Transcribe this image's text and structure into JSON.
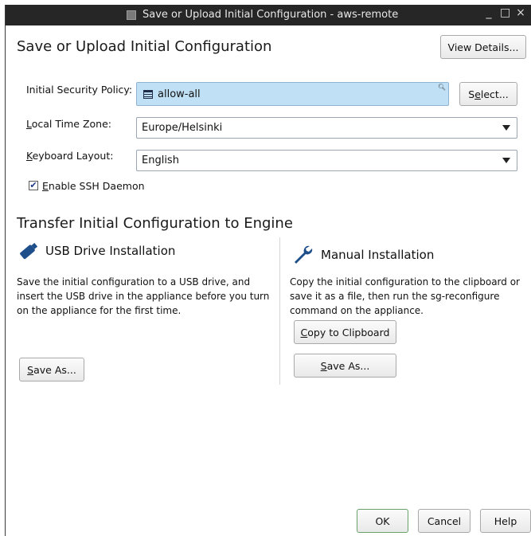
{
  "window": {
    "title": "Save or Upload Initial Configuration - aws-remote",
    "controls": [
      "_",
      "□",
      "×"
    ]
  },
  "header": {
    "title": "Save or Upload Initial Configuration",
    "view_details_label": "View Details..."
  },
  "form": {
    "policy_label": "Initial Security Policy:",
    "policy_value": "allow-all",
    "select_button": {
      "pre": "S",
      "under": "e",
      "post": "lect..."
    },
    "timezone_label": {
      "pre": "",
      "under": "L",
      "post": "ocal Time Zone:"
    },
    "timezone_value": "Europe/Helsinki",
    "keyboard_label": {
      "pre": "",
      "under": "K",
      "post": "eyboard Layout:"
    },
    "keyboard_value": "English",
    "ssh_label": {
      "pre": "",
      "under": "E",
      "post": "nable SSH Daemon"
    },
    "ssh_checked": true
  },
  "transfer": {
    "title": "Transfer Initial Configuration to Engine",
    "usb": {
      "title": "USB Drive Installation",
      "lines": [
        "Save the initial configuration to a USB drive, and",
        "insert the USB drive in the appliance before you turn",
        "on the appliance for the first time."
      ],
      "save_as": {
        "pre": "",
        "under": "S",
        "post": "ave As..."
      }
    },
    "manual": {
      "title": "Manual Installation",
      "lines": [
        "Copy the initial configuration to the clipboard or",
        "save it as a file, then run the sg-reconfigure",
        "command on the appliance."
      ],
      "copy": {
        "pre": "",
        "under": "C",
        "post": "opy to Clipboard"
      },
      "save_as": {
        "pre": "",
        "under": "S",
        "post": "ave As..."
      }
    }
  },
  "footer": {
    "ok": "OK",
    "cancel": "Cancel",
    "help": "Help"
  },
  "colors": {
    "titlebar": "#262626",
    "policy_field": "#bfe0f5",
    "icon_blue": "#1f4f8a"
  }
}
